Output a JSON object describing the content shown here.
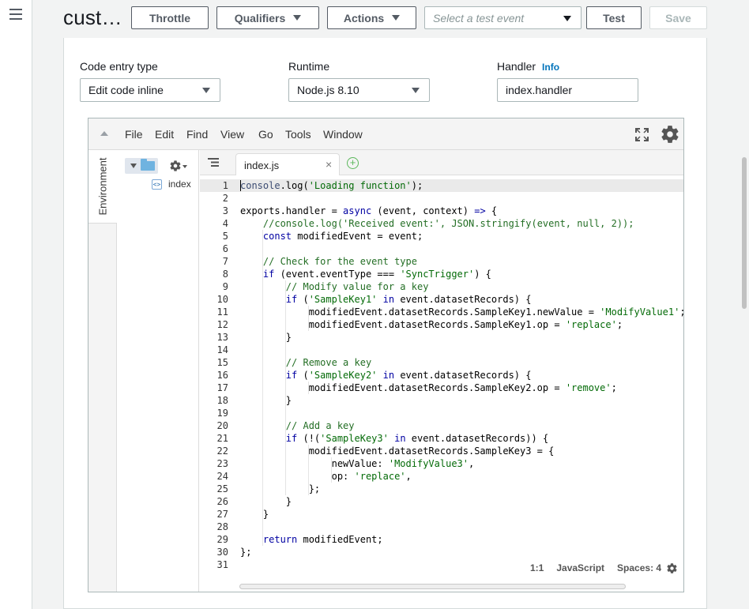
{
  "header": {
    "function_title": "cust…",
    "throttle_label": "Throttle",
    "qualifiers_label": "Qualifiers",
    "actions_label": "Actions",
    "test_event_placeholder": "Select a test event",
    "test_label": "Test",
    "save_label": "Save"
  },
  "config": {
    "code_entry_label": "Code entry type",
    "code_entry_value": "Edit code inline",
    "runtime_label": "Runtime",
    "runtime_value": "Node.js 8.10",
    "handler_label": "Handler",
    "info_link": "Info",
    "handler_value": "index.handler"
  },
  "ide": {
    "menu": [
      "File",
      "Edit",
      "Find",
      "View",
      "Go",
      "Tools",
      "Window"
    ],
    "environment_label": "Environment",
    "tree_file": "index",
    "tab_label": "index.js",
    "tab_close": "×",
    "tab_add": "+",
    "status": {
      "position": "1:1",
      "language": "JavaScript",
      "spaces": "Spaces: 4"
    }
  },
  "icons": {
    "menu": "hamburger-icon",
    "fullscreen": "fullscreen-icon",
    "settings": "gear-icon",
    "folder": "folder-icon",
    "file": "code-file-icon"
  },
  "colors": {
    "keyword": "#0000a2",
    "string": "#036a07",
    "comment": "#236e24",
    "active_line": "#eaeaea"
  }
}
